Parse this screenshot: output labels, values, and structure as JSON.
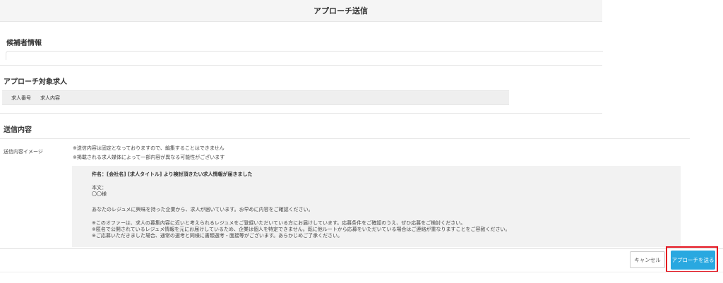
{
  "header": {
    "title": "アプローチ送信"
  },
  "sections": {
    "candidate": {
      "title": "候補者情報"
    },
    "job": {
      "title": "アプローチ対象求人",
      "columns": [
        "求人番号",
        "求人内容"
      ]
    },
    "send": {
      "title": "送信内容",
      "label": "送信内容イメージ",
      "notes": [
        "※送信内容は固定となっておりますので、編集することはできません",
        "※掲載される求人媒体によって一部内容が異なる可能性がございます"
      ]
    }
  },
  "preview": {
    "subject": "件名：[会社名] [求人タイトル] より検討頂きたい求人情報が届きました",
    "body_label": "本文：",
    "recipient": "〇〇様",
    "paragraph1": "あなたのレジュメに興味を持った企業から、求人が届いています。お早めに内容をご確認ください。",
    "notes": [
      "※このオファーは、求人の募集内容に近いと考えられるレジュメをご登録いただいている方にお届けしています。応募条件をご確認のうえ、ぜひ応募をご検討ください。",
      "※匿名で公開されているレジュメ情報を元にお届けしているため、企業は個人を特定できません。既に他ルートから応募をいただいている場合はご連絡が重なりますことをご容赦ください。",
      "※ご応募いただきました場合、通常の選考と同様に書類選考・面接等がございます。あらかじめご了承ください。"
    ]
  },
  "footer": {
    "cancel_label": "キャンセル",
    "send_label": "アプローチを送る",
    "highlight_color": "#e3141f",
    "send_color": "#29a8e0"
  }
}
